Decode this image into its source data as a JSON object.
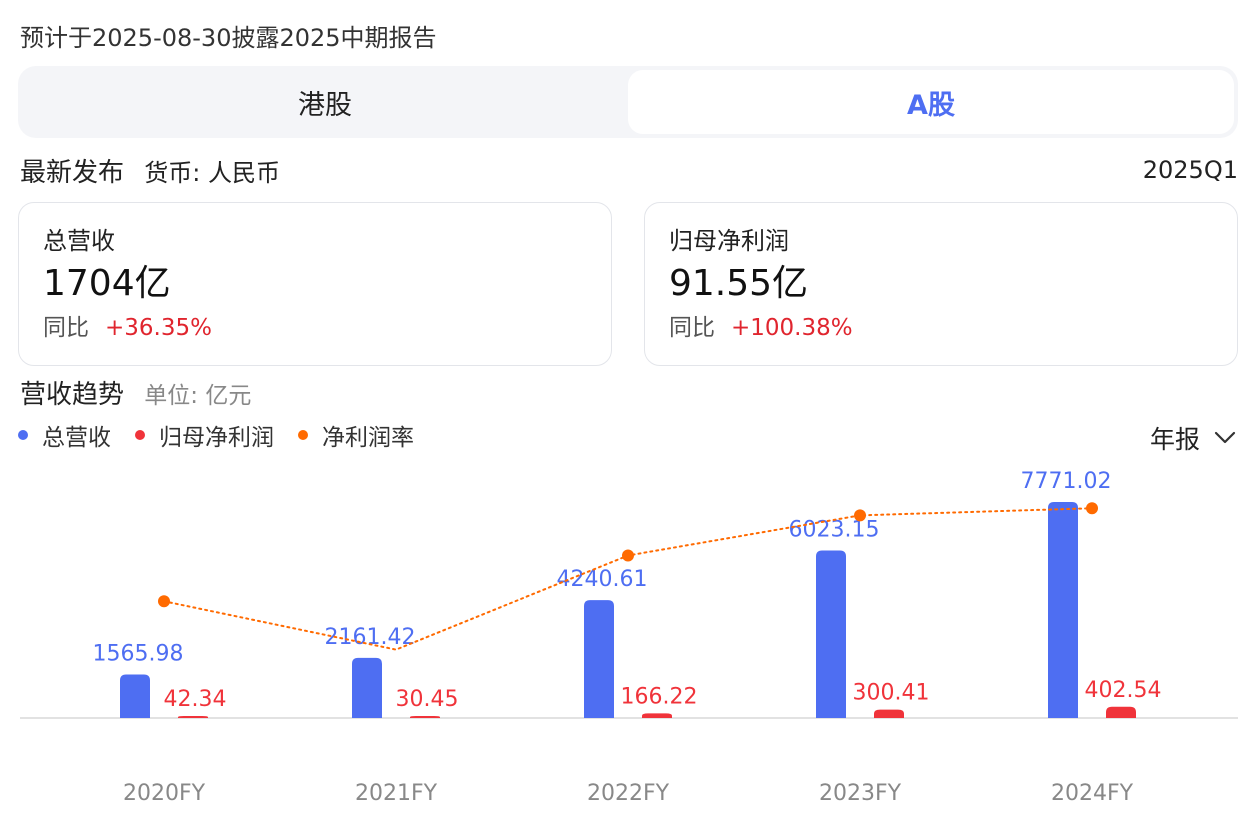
{
  "notice": "预计于2025-08-30披露2025中期报告",
  "tabs": [
    {
      "label": "港股",
      "active": false
    },
    {
      "label": "A股",
      "active": true
    }
  ],
  "latest": {
    "title": "最新发布",
    "currency": "货币: 人民币",
    "period": "2025Q1"
  },
  "cards": [
    {
      "label": "总营收",
      "value": "1704亿",
      "yoy_label": "同比",
      "yoy_value": "+36.35%"
    },
    {
      "label": "归母净利润",
      "value": "91.55亿",
      "yoy_label": "同比",
      "yoy_value": "+100.38%"
    }
  ],
  "trend": {
    "title": "营收趋势",
    "unit": "单位: 亿元",
    "period_select": "年报",
    "select_icon": "chevron-down-icon"
  },
  "colors": {
    "revenue": "#4e6ef2",
    "profit": "#f0333a",
    "margin": "#ff6a00",
    "positive": "#e0252e"
  },
  "chart_data": {
    "type": "bar",
    "categories": [
      "2020FY",
      "2021FY",
      "2022FY",
      "2023FY",
      "2024FY"
    ],
    "series": [
      {
        "name": "总营收",
        "type": "bar",
        "values": [
          1565.98,
          2161.42,
          4240.61,
          6023.15,
          7771.02
        ]
      },
      {
        "name": "归母净利润",
        "type": "bar",
        "values": [
          42.34,
          30.45,
          166.22,
          300.41,
          402.54
        ]
      },
      {
        "name": "净利润率",
        "type": "line",
        "values": [
          2.7,
          1.41,
          3.92,
          4.99,
          5.18
        ]
      }
    ],
    "grid": false,
    "legend": "top-left"
  }
}
